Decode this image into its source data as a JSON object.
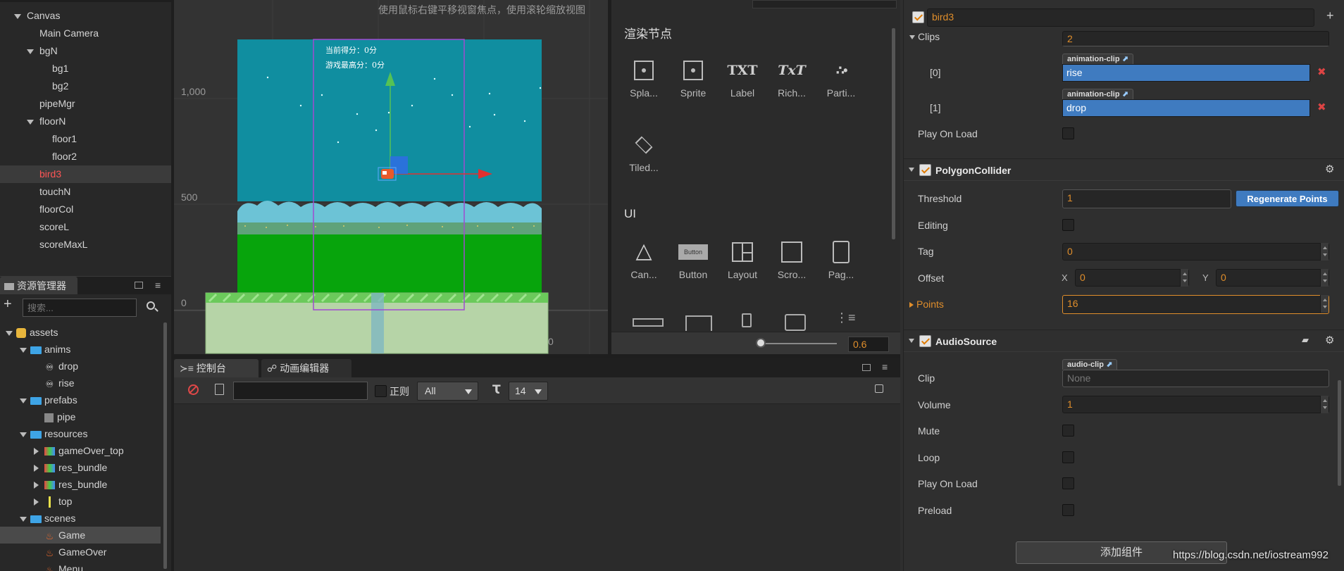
{
  "hierarchy": {
    "items": [
      {
        "label": "Canvas",
        "indent": 0,
        "expand": "down"
      },
      {
        "label": "Main Camera",
        "indent": 1,
        "expand": ""
      },
      {
        "label": "bgN",
        "indent": 1,
        "expand": "down"
      },
      {
        "label": "bg1",
        "indent": 2,
        "expand": ""
      },
      {
        "label": "bg2",
        "indent": 2,
        "expand": ""
      },
      {
        "label": "pipeMgr",
        "indent": 1,
        "expand": ""
      },
      {
        "label": "floorN",
        "indent": 1,
        "expand": "down"
      },
      {
        "label": "floor1",
        "indent": 2,
        "expand": ""
      },
      {
        "label": "floor2",
        "indent": 2,
        "expand": ""
      },
      {
        "label": "bird3",
        "indent": 1,
        "expand": "",
        "selected": true
      },
      {
        "label": "touchN",
        "indent": 1,
        "expand": ""
      },
      {
        "label": "floorCol",
        "indent": 1,
        "expand": ""
      },
      {
        "label": "scoreL",
        "indent": 1,
        "expand": ""
      },
      {
        "label": "scoreMaxL",
        "indent": 1,
        "expand": ""
      }
    ]
  },
  "assets": {
    "tab_label": "资源管理器",
    "search_placeholder": "搜索...",
    "items": [
      {
        "label": "assets",
        "indent": 0,
        "icon": "assets",
        "expand": "down"
      },
      {
        "label": "anims",
        "indent": 1,
        "icon": "folder",
        "expand": "down"
      },
      {
        "label": "drop",
        "indent": 2,
        "icon": "anim",
        "expand": ""
      },
      {
        "label": "rise",
        "indent": 2,
        "icon": "anim",
        "expand": ""
      },
      {
        "label": "prefabs",
        "indent": 1,
        "icon": "folder",
        "expand": "down"
      },
      {
        "label": "pipe",
        "indent": 2,
        "icon": "prefab",
        "expand": ""
      },
      {
        "label": "resources",
        "indent": 1,
        "icon": "folder",
        "expand": "down"
      },
      {
        "label": "gameOver_top",
        "indent": 2,
        "icon": "atlas",
        "expand": "right"
      },
      {
        "label": "res_bundle",
        "indent": 2,
        "icon": "atlas",
        "expand": "right"
      },
      {
        "label": "res_bundle",
        "indent": 2,
        "icon": "atlas",
        "expand": "right"
      },
      {
        "label": "top",
        "indent": 2,
        "icon": "bar",
        "expand": "right"
      },
      {
        "label": "scenes",
        "indent": 1,
        "icon": "folder",
        "expand": "down"
      },
      {
        "label": "Game",
        "indent": 2,
        "icon": "scene",
        "expand": "",
        "selected": true
      },
      {
        "label": "GameOver",
        "indent": 2,
        "icon": "scene",
        "expand": ""
      },
      {
        "label": "Menu",
        "indent": 2,
        "icon": "scene",
        "expand": ""
      }
    ]
  },
  "scene": {
    "hint": "使用鼠标右键平移视窗焦点，使用滚轮缩放视图",
    "ruler_1000": "1,000",
    "ruler_500": "500",
    "ruler_0": "0",
    "ruler_x0": "0",
    "score_text": "当前得分：0分",
    "max_score_text": "游戏最高分：0分"
  },
  "library": {
    "render_title": "渲染节点",
    "render_items": [
      {
        "label": "Spla...",
        "icon": "splash-icon"
      },
      {
        "label": "Sprite",
        "icon": "sprite-icon"
      },
      {
        "label": "Label",
        "icon": "label-icon",
        "glyph": "TXT"
      },
      {
        "label": "Rich...",
        "icon": "richtext-icon",
        "glyph": "TxT"
      },
      {
        "label": "Parti...",
        "icon": "particle-icon"
      },
      {
        "label": "Tiled...",
        "icon": "tiled-icon"
      }
    ],
    "ui_title": "UI",
    "ui_items": [
      {
        "label": "Can...",
        "icon": "canvas-icon"
      },
      {
        "label": "Button",
        "icon": "button-icon",
        "glyph": "Button"
      },
      {
        "label": "Layout",
        "icon": "layout-icon"
      },
      {
        "label": "Scro...",
        "icon": "scrollview-icon"
      },
      {
        "label": "Pag...",
        "icon": "pageview-icon"
      }
    ],
    "zoom_value": "0.6"
  },
  "console": {
    "tab_console": "控制台",
    "tab_anim": "动画编辑器",
    "regex_label": "正则",
    "filter_value": "All",
    "font_size": "14"
  },
  "inspector": {
    "node_name": "bird3",
    "clips_label": "Clips",
    "clips_count": "2",
    "clip_tag": "animation-clip",
    "clip0_index": "[0]",
    "clip0_name": "rise",
    "clip1_index": "[1]",
    "clip1_name": "drop",
    "play_on_load_label": "Play On Load",
    "polygon": {
      "title": "PolygonCollider",
      "threshold_label": "Threshold",
      "threshold_value": "1",
      "regen_label": "Regenerate Points",
      "editing_label": "Editing",
      "tag_label": "Tag",
      "tag_value": "0",
      "offset_label": "Offset",
      "x_label": "X",
      "x_value": "0",
      "y_label": "Y",
      "y_value": "0",
      "points_label": "Points",
      "points_value": "16"
    },
    "audio": {
      "title": "AudioSource",
      "clip_label": "Clip",
      "clip_tag": "audio-clip",
      "clip_value": "None",
      "volume_label": "Volume",
      "volume_value": "1",
      "mute_label": "Mute",
      "loop_label": "Loop",
      "play_on_load_label": "Play On Load",
      "preload_label": "Preload"
    },
    "add_component": "添加组件"
  },
  "watermark": "https://blog.csdn.net/iostream992"
}
